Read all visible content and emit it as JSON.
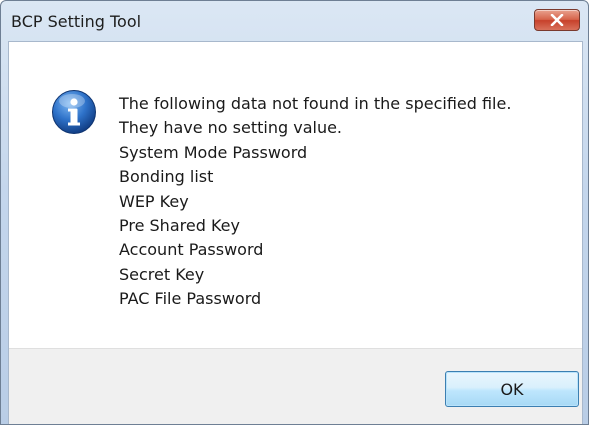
{
  "window": {
    "title": "BCP Setting Tool",
    "close_icon": "close-icon"
  },
  "dialog": {
    "icon": "info-icon",
    "message_lines": [
      "The following data not found in the specified file.",
      "They have no setting value.",
      "System Mode Password",
      "Bonding list",
      "WEP Key",
      "Pre Shared Key",
      "Account Password",
      "Secret Key",
      "PAC File Password"
    ]
  },
  "buttons": {
    "ok_label": "OK"
  },
  "colors": {
    "close_button": "#c7402a",
    "info_icon": "#1f5fb8",
    "ok_button_border": "#3c7fb1"
  }
}
